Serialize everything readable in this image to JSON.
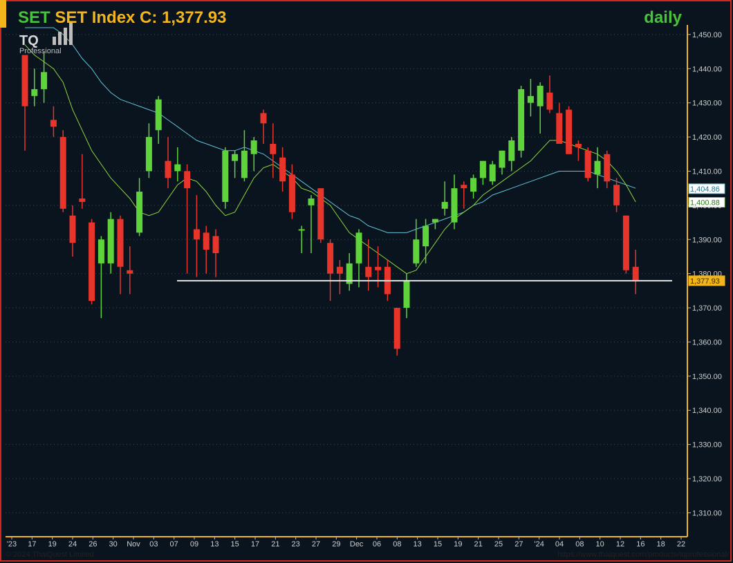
{
  "header": {
    "symbol": "SET",
    "title_rest": " SET Index C: 1,377.93",
    "period": "daily"
  },
  "logo": {
    "mark": "TQ",
    "sub": "Professional"
  },
  "footer": {
    "copyright": "© 2024 ThaiQuest Limited",
    "url": "https://www.thaiquest.com/products/tqprofessional/"
  },
  "colors": {
    "background": "#0a141e",
    "up": "#5fd33a",
    "down": "#e8352b",
    "ma_short": "#8ed83f",
    "ma_long": "#5fc4d8",
    "support_line": "#e6e6e6",
    "axis_text": "#cfcfcf",
    "title_green": "#47c23a",
    "title_gold": "#f2b51c",
    "border_red": "#d0271f"
  },
  "chart_data": {
    "type": "candlestick",
    "ylim": [
      1303,
      1452
    ],
    "y_ticks": [
      1310,
      1320,
      1330,
      1340,
      1350,
      1360,
      1370,
      1380,
      1390,
      1400,
      1410,
      1420,
      1430,
      1440,
      1450
    ],
    "x_tick_labels": [
      "'23",
      "17",
      "19",
      "24",
      "26",
      "30",
      "Nov",
      "03",
      "07",
      "09",
      "13",
      "15",
      "17",
      "21",
      "23",
      "27",
      "29",
      "Dec",
      "06",
      "08",
      "13",
      "15",
      "19",
      "21",
      "25",
      "27",
      "'24",
      "04",
      "08",
      "10",
      "12",
      "16",
      "18",
      "22"
    ],
    "price_labels": [
      {
        "value": 1404.86,
        "text": "1,404.86",
        "style": "ma_long"
      },
      {
        "value": 1400.88,
        "text": "1,400.88",
        "style": "ma_short"
      },
      {
        "value": 1377.93,
        "text": "1,377.93",
        "style": "close"
      }
    ],
    "support_level": 1377.93,
    "candles": [
      {
        "o": 1444,
        "h": 1444,
        "l": 1416,
        "c": 1429
      },
      {
        "o": 1432,
        "h": 1440,
        "l": 1429,
        "c": 1434
      },
      {
        "o": 1434,
        "h": 1445,
        "l": 1430,
        "c": 1439
      },
      {
        "o": 1425,
        "h": 1429,
        "l": 1420,
        "c": 1423
      },
      {
        "o": 1420,
        "h": 1422,
        "l": 1398,
        "c": 1399
      },
      {
        "o": 1397,
        "h": 1400,
        "l": 1385,
        "c": 1389
      },
      {
        "o": 1402,
        "h": 1415,
        "l": 1399,
        "c": 1401
      },
      {
        "o": 1395,
        "h": 1396,
        "l": 1371,
        "c": 1372
      },
      {
        "o": 1383,
        "h": 1391,
        "l": 1367,
        "c": 1390
      },
      {
        "o": 1383,
        "h": 1398,
        "l": 1380,
        "c": 1396
      },
      {
        "o": 1396,
        "h": 1397,
        "l": 1374,
        "c": 1382
      },
      {
        "o": 1381,
        "h": 1388,
        "l": 1374,
        "c": 1380
      },
      {
        "o": 1392,
        "h": 1408,
        "l": 1391,
        "c": 1404
      },
      {
        "o": 1410,
        "h": 1424,
        "l": 1408,
        "c": 1420
      },
      {
        "o": 1422,
        "h": 1432,
        "l": 1418,
        "c": 1431
      },
      {
        "o": 1413,
        "h": 1420,
        "l": 1405,
        "c": 1408
      },
      {
        "o": 1410,
        "h": 1417,
        "l": 1407,
        "c": 1412
      },
      {
        "o": 1410,
        "h": 1412,
        "l": 1380,
        "c": 1405
      },
      {
        "o": 1393,
        "h": 1403,
        "l": 1379,
        "c": 1390
      },
      {
        "o": 1392,
        "h": 1394,
        "l": 1380,
        "c": 1387
      },
      {
        "o": 1391,
        "h": 1393,
        "l": 1379,
        "c": 1386
      },
      {
        "o": 1401,
        "h": 1417,
        "l": 1399,
        "c": 1416
      },
      {
        "o": 1413,
        "h": 1416,
        "l": 1408,
        "c": 1415
      },
      {
        "o": 1408,
        "h": 1422,
        "l": 1407,
        "c": 1416
      },
      {
        "o": 1415,
        "h": 1420,
        "l": 1410,
        "c": 1419
      },
      {
        "o": 1427,
        "h": 1428,
        "l": 1418,
        "c": 1424
      },
      {
        "o": 1418,
        "h": 1424,
        "l": 1408,
        "c": 1415
      },
      {
        "o": 1414,
        "h": 1417,
        "l": 1404,
        "c": 1407
      },
      {
        "o": 1409,
        "h": 1412,
        "l": 1396,
        "c": 1398
      },
      {
        "o": 1393,
        "h": 1394,
        "l": 1386,
        "c": 1393
      },
      {
        "o": 1400,
        "h": 1403,
        "l": 1386,
        "c": 1402
      },
      {
        "o": 1405,
        "h": 1405,
        "l": 1389,
        "c": 1390
      },
      {
        "o": 1389,
        "h": 1390,
        "l": 1372,
        "c": 1380
      },
      {
        "o": 1382,
        "h": 1384,
        "l": 1374,
        "c": 1380
      },
      {
        "o": 1377,
        "h": 1386,
        "l": 1375,
        "c": 1383
      },
      {
        "o": 1383,
        "h": 1393,
        "l": 1376,
        "c": 1392
      },
      {
        "o": 1382,
        "h": 1390,
        "l": 1375,
        "c": 1379
      },
      {
        "o": 1382,
        "h": 1388,
        "l": 1376,
        "c": 1381
      },
      {
        "o": 1382,
        "h": 1384,
        "l": 1372,
        "c": 1374
      },
      {
        "o": 1370,
        "h": 1370,
        "l": 1356,
        "c": 1358
      },
      {
        "o": 1370,
        "h": 1380,
        "l": 1367,
        "c": 1378
      },
      {
        "o": 1383,
        "h": 1396,
        "l": 1382,
        "c": 1390
      },
      {
        "o": 1388,
        "h": 1396,
        "l": 1383,
        "c": 1394
      },
      {
        "o": 1395,
        "h": 1396,
        "l": 1393,
        "c": 1396
      },
      {
        "o": 1399,
        "h": 1407,
        "l": 1397,
        "c": 1401
      },
      {
        "o": 1395,
        "h": 1409,
        "l": 1393,
        "c": 1405
      },
      {
        "o": 1406,
        "h": 1407,
        "l": 1399,
        "c": 1405
      },
      {
        "o": 1404,
        "h": 1409,
        "l": 1402,
        "c": 1408
      },
      {
        "o": 1408,
        "h": 1413,
        "l": 1406,
        "c": 1413
      },
      {
        "o": 1407,
        "h": 1413,
        "l": 1406,
        "c": 1412
      },
      {
        "o": 1411,
        "h": 1416,
        "l": 1409,
        "c": 1416
      },
      {
        "o": 1413,
        "h": 1420,
        "l": 1410,
        "c": 1419
      },
      {
        "o": 1416,
        "h": 1435,
        "l": 1414,
        "c": 1434
      },
      {
        "o": 1430,
        "h": 1437,
        "l": 1426,
        "c": 1432
      },
      {
        "o": 1429,
        "h": 1436,
        "l": 1421,
        "c": 1435
      },
      {
        "o": 1433,
        "h": 1438,
        "l": 1427,
        "c": 1428
      },
      {
        "o": 1427,
        "h": 1430,
        "l": 1419,
        "c": 1418
      },
      {
        "o": 1428,
        "h": 1429,
        "l": 1415,
        "c": 1415
      },
      {
        "o": 1418,
        "h": 1419,
        "l": 1413,
        "c": 1417
      },
      {
        "o": 1416,
        "h": 1417,
        "l": 1407,
        "c": 1408
      },
      {
        "o": 1409,
        "h": 1417,
        "l": 1405,
        "c": 1413
      },
      {
        "o": 1415,
        "h": 1416,
        "l": 1405,
        "c": 1407
      },
      {
        "o": 1406,
        "h": 1408,
        "l": 1398,
        "c": 1400
      },
      {
        "o": 1397,
        "h": 1397,
        "l": 1380,
        "c": 1381
      },
      {
        "o": 1382,
        "h": 1387,
        "l": 1374,
        "c": 1377.93
      }
    ],
    "ma_short": [
      1447,
      1444,
      1442,
      1440,
      1436,
      1428,
      1422,
      1416,
      1412,
      1408,
      1405,
      1402,
      1398,
      1397,
      1398,
      1402,
      1406,
      1408,
      1407,
      1404,
      1400,
      1397,
      1398,
      1403,
      1408,
      1411,
      1412,
      1410,
      1408,
      1405,
      1404,
      1402,
      1400,
      1396,
      1392,
      1390,
      1388,
      1386,
      1384,
      1382,
      1380,
      1381,
      1385,
      1389,
      1393,
      1396,
      1398,
      1400,
      1403,
      1405,
      1407,
      1409,
      1411,
      1413,
      1416,
      1419,
      1419,
      1418,
      1417,
      1416,
      1415,
      1413,
      1410,
      1406,
      1401
    ],
    "ma_long": [
      1458,
      1456,
      1454,
      1452,
      1450,
      1447,
      1443,
      1440,
      1436,
      1433,
      1431,
      1430,
      1429,
      1428,
      1427,
      1425,
      1423,
      1421,
      1419,
      1418,
      1417,
      1416,
      1416,
      1417,
      1416,
      1415,
      1413,
      1411,
      1409,
      1407,
      1405,
      1403,
      1401,
      1399,
      1397,
      1396,
      1394,
      1393,
      1392,
      1392,
      1392,
      1393,
      1394,
      1395,
      1396,
      1397,
      1398,
      1400,
      1401,
      1403,
      1404,
      1405,
      1406,
      1407,
      1408,
      1409,
      1410,
      1410,
      1410,
      1410,
      1409,
      1408,
      1407,
      1406,
      1405
    ]
  }
}
